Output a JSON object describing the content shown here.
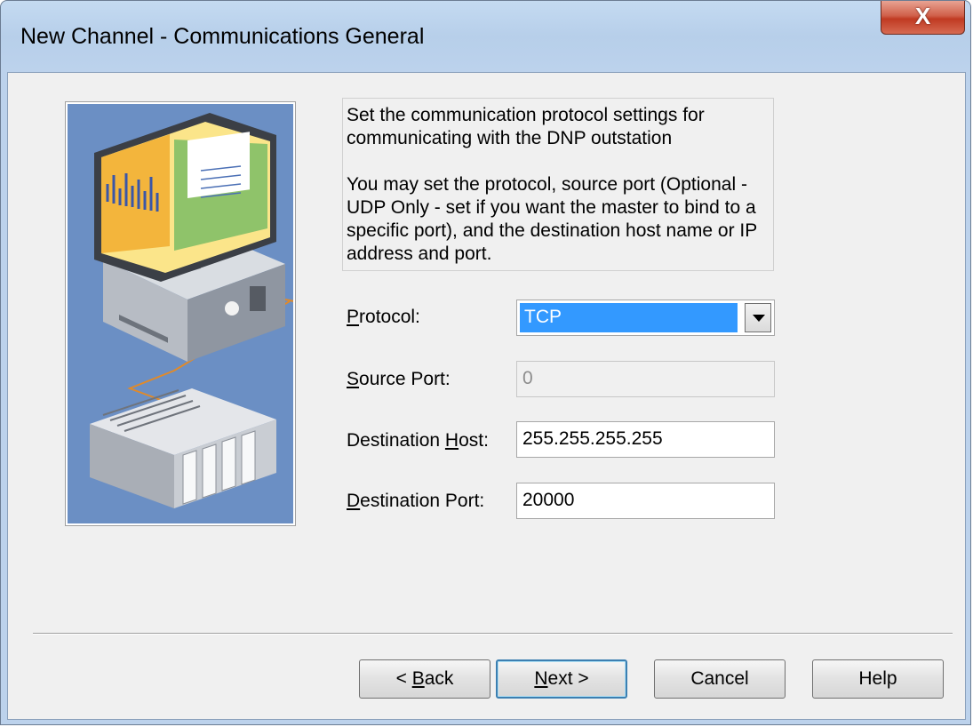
{
  "window": {
    "title": "New Channel - Communications General",
    "close_label": "X"
  },
  "description": "Set the communication protocol settings for communicating with the DNP outstation\n\nYou may set the protocol, source port (Optional - UDP Only - set if you want the master to bind to a specific port), and the destination host name or IP address and port.",
  "form": {
    "protocol_label": "Protocol:",
    "protocol_value": "TCP",
    "source_port_label": "Source Port:",
    "source_port_value": "0",
    "dest_host_label": "Destination Host:",
    "dest_host_value": "255.255.255.255",
    "dest_port_label": "Destination Port:",
    "dest_port_value": "20000"
  },
  "buttons": {
    "back": "< Back",
    "next": "Next >",
    "cancel": "Cancel",
    "help": "Help"
  },
  "icons": {
    "illustration": "computer-and-plc-illustration",
    "dropdown": "chevron-down-icon",
    "close": "close-icon"
  },
  "colors": {
    "illustration_bg": "#6b8fc4",
    "selection": "#3399ff",
    "close_button": "#c94a33"
  }
}
